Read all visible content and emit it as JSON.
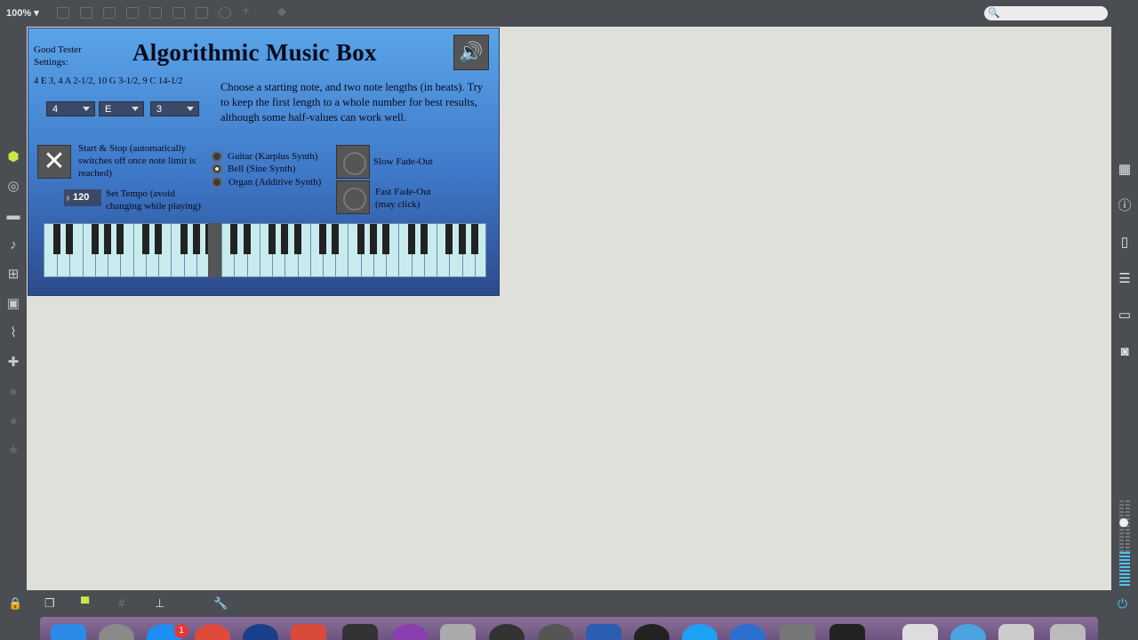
{
  "toolbar": {
    "zoom": "100% ▾"
  },
  "app": {
    "title": "Algorithmic Music Box",
    "tester_label": "Good Tester Settings:",
    "tester_values": "4 E 3, 4 A 2-1/2, 10 G 3-1/2, 9 C 14-1/2",
    "description": "Choose a starting note, and two note lengths (in beats). Try to keep the first length to a whole number for best results, although some half-values can work well.",
    "dropdowns": [
      {
        "name": "start-note-number",
        "value": "4"
      },
      {
        "name": "start-note-letter",
        "value": "E"
      },
      {
        "name": "note-length",
        "value": "3"
      }
    ],
    "start_stop_label": "Start & Stop (automatically switches off once note limit is reached)",
    "tempo_value": "120",
    "tempo_label": "Set Tempo (avoid changing while playing)",
    "instruments": [
      {
        "label": "Guitar (Karplus Synth)",
        "selected": false
      },
      {
        "label": "Bell (Sine Synth)",
        "selected": true
      },
      {
        "label": "Organ (Additive Synth)",
        "selected": false
      }
    ],
    "slow_fade": "Slow Fade-Out",
    "fast_fade": "Fast Fade-Out (may click)"
  },
  "icons": {
    "close": "✕",
    "speaker": "🔊",
    "search": "🔍",
    "power": "⏻"
  }
}
